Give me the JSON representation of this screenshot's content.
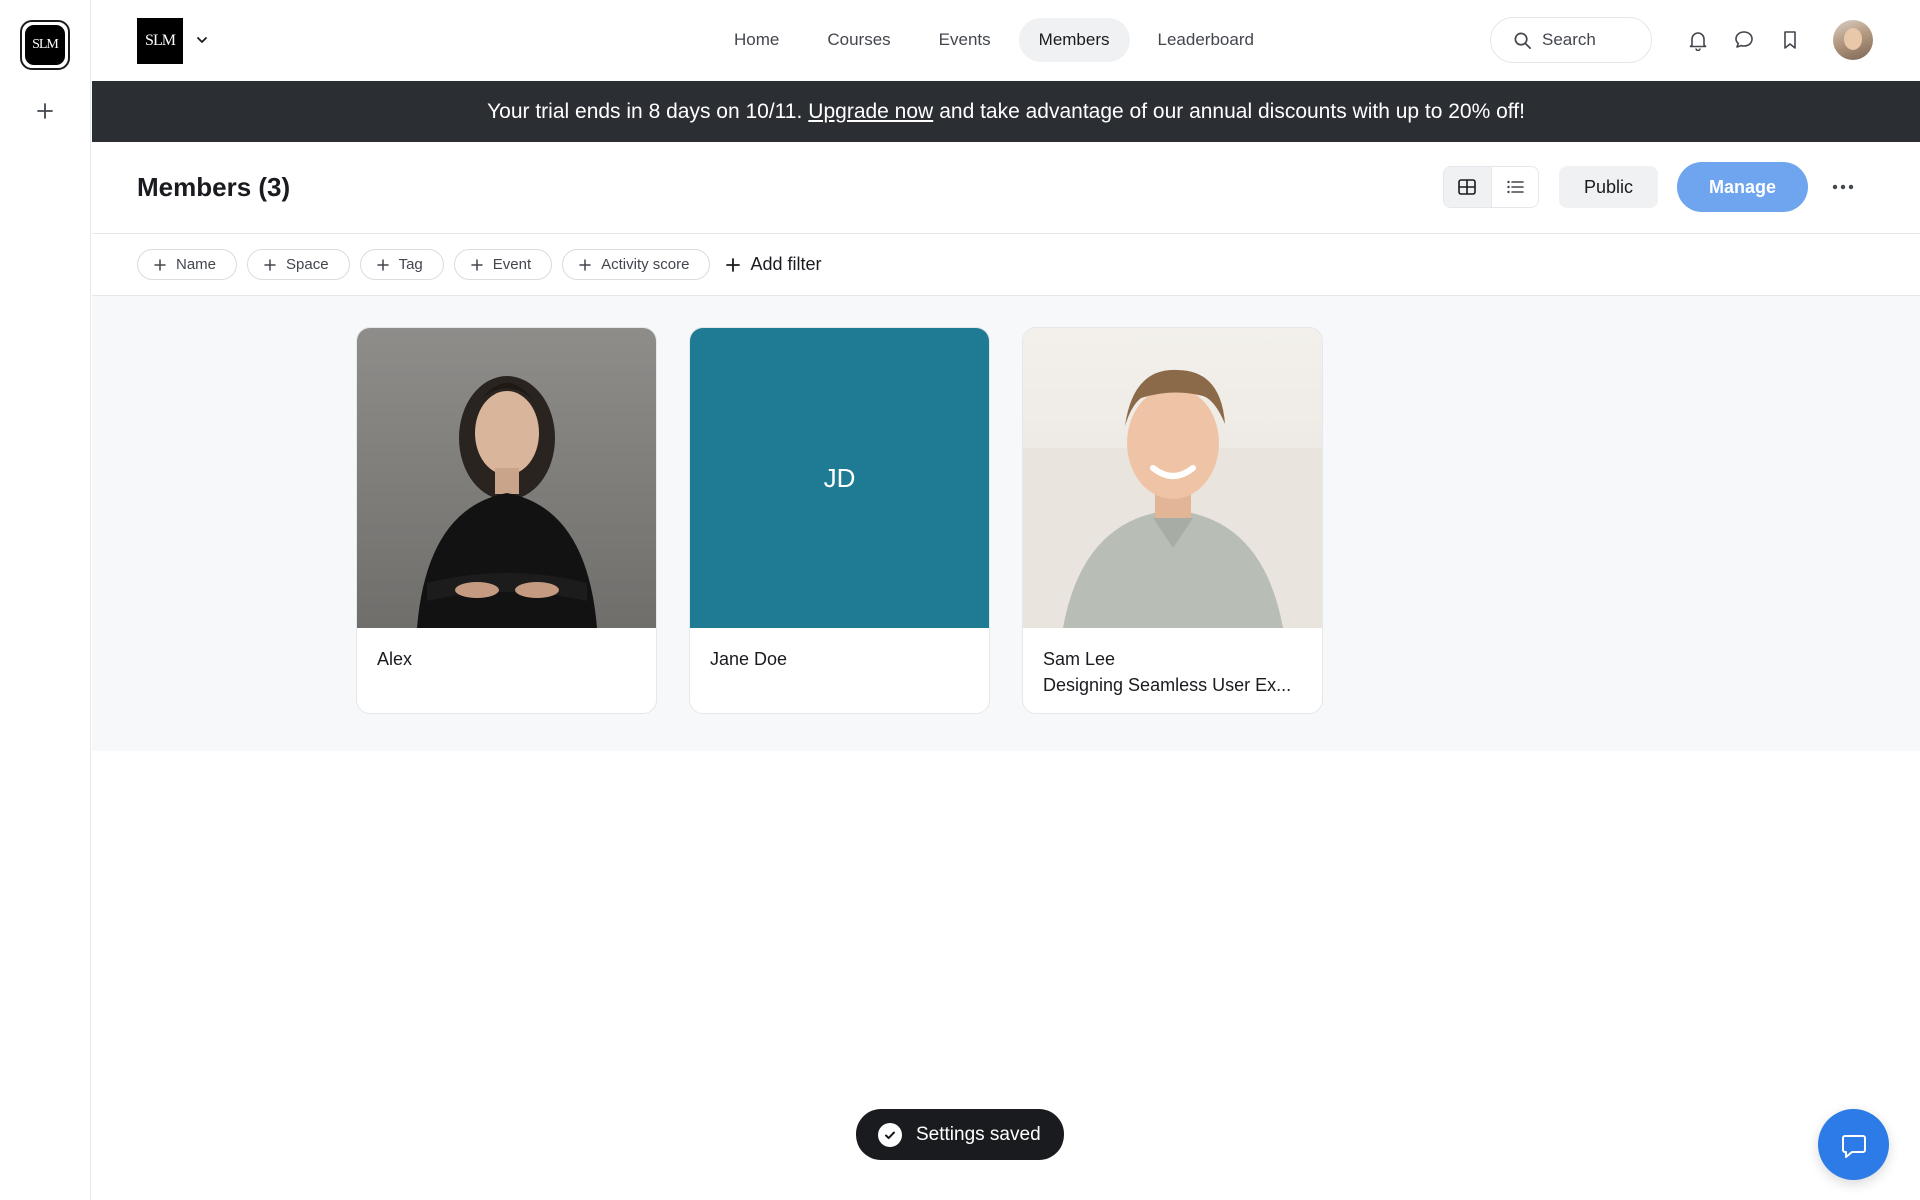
{
  "rail": {
    "logo_text": "SLM",
    "add_icon": "plus-icon"
  },
  "header": {
    "brand_text": "SLM",
    "nav": [
      {
        "label": "Home",
        "active": false
      },
      {
        "label": "Courses",
        "active": false
      },
      {
        "label": "Events",
        "active": false
      },
      {
        "label": "Members",
        "active": true
      },
      {
        "label": "Leaderboard",
        "active": false
      }
    ],
    "search_label": "Search",
    "icons": [
      "bell-icon",
      "chat-icon",
      "bookmark-icon"
    ]
  },
  "banner": {
    "text_before": "Your trial ends in 8 days on 10/11.",
    "link": "Upgrade now",
    "text_after": "and take advantage of our annual discounts with up to 20% off!"
  },
  "page": {
    "title": "Members (3)",
    "public_label": "Public",
    "manage_label": "Manage"
  },
  "filters": {
    "chips": [
      "Name",
      "Space",
      "Tag",
      "Event",
      "Activity score"
    ],
    "add_filter_label": "Add filter"
  },
  "members": [
    {
      "name": "Alex",
      "subtitle": "",
      "avatar": "photo"
    },
    {
      "name": "Jane Doe",
      "subtitle": "",
      "avatar": "initials",
      "initials": "JD",
      "color": "#1f7b93"
    },
    {
      "name": "Sam Lee",
      "subtitle": "Designing Seamless User Ex...",
      "avatar": "photo"
    }
  ],
  "toast": {
    "text": "Settings saved"
  },
  "colors": {
    "banner_bg": "#2b2e33",
    "manage_bg": "#6ea5ee",
    "chat_fab_bg": "#2d7be6",
    "initials_bg": "#1f7b93"
  }
}
